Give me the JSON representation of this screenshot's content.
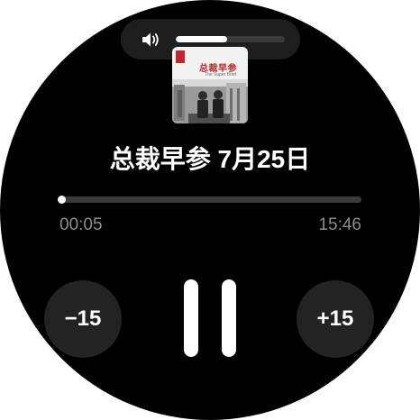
{
  "player": {
    "volume": {
      "icon": "speaker-volume-icon",
      "level": 0.47
    },
    "cover": {
      "title": "总裁早参",
      "subtitle": "The Super Brief",
      "image": "podcast-cover-art"
    },
    "title": "总裁早参 7月25日",
    "progress": {
      "elapsed": "00:05",
      "total": "15:46",
      "fraction": 0.005
    },
    "controls": {
      "rewind_label": "−15",
      "forward_label": "+15",
      "play_state_icon": "pause-icon"
    }
  },
  "colors": {
    "background": "#000000",
    "surface": "#232323",
    "text": "#ffffff",
    "muted_text": "#8c8c8c",
    "cover_accent": "#c0282d"
  }
}
